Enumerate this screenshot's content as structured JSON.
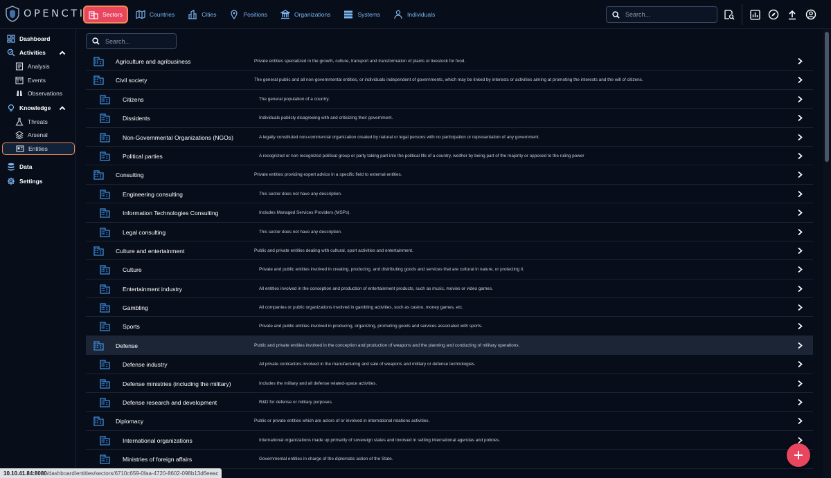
{
  "app": {
    "name": "OPENCTI"
  },
  "topnav": {
    "tabs": [
      {
        "label": "Sectors",
        "icon": "building-icon",
        "active": true
      },
      {
        "label": "Countries",
        "icon": "map-icon",
        "active": false
      },
      {
        "label": "Cities",
        "icon": "city-icon",
        "active": false
      },
      {
        "label": "Positions",
        "icon": "map-pin-icon",
        "active": false
      },
      {
        "label": "Organizations",
        "icon": "bank-icon",
        "active": false
      },
      {
        "label": "Systems",
        "icon": "server-icon",
        "active": false
      },
      {
        "label": "Individuals",
        "icon": "person-icon",
        "active": false
      }
    ],
    "search_placeholder": "Search...",
    "right_icons": [
      "search-document-icon",
      "dashboard-icon",
      "compass-icon",
      "upload-icon",
      "account-icon"
    ]
  },
  "sidebar": {
    "items": [
      {
        "label": "Dashboard",
        "icon": "dashboard-grid-icon",
        "level": "top"
      },
      {
        "label": "Activities",
        "icon": "activities-icon",
        "level": "top",
        "expanded": true
      },
      {
        "label": "Analysis",
        "icon": "analysis-icon",
        "level": "sub"
      },
      {
        "label": "Events",
        "icon": "events-icon",
        "level": "sub"
      },
      {
        "label": "Observations",
        "icon": "binoculars-icon",
        "level": "sub"
      },
      {
        "label": "Knowledge",
        "icon": "knowledge-icon",
        "level": "top",
        "expanded": true
      },
      {
        "label": "Threats",
        "icon": "threats-icon",
        "level": "sub"
      },
      {
        "label": "Arsenal",
        "icon": "arsenal-icon",
        "level": "sub"
      },
      {
        "label": "Entities",
        "icon": "entities-icon",
        "level": "sub",
        "selected": true
      },
      {
        "label": "Data",
        "icon": "database-icon",
        "level": "top"
      },
      {
        "label": "Settings",
        "icon": "settings-icon",
        "level": "top"
      }
    ]
  },
  "list": {
    "search_placeholder": "Search...",
    "rows": [
      {
        "name": "Agriculture and agribusiness",
        "level": "parent",
        "description": "Private entities specialized in the growth, culture, transport and transformation of plants or livestock for food."
      },
      {
        "name": "Civil society",
        "level": "parent",
        "description": "The general public and all non-governmental entities, or individuals independent of governments, which may be linked by interests or activities aiming at promoting the interests and the will of citizens."
      },
      {
        "name": "Citizens",
        "level": "child",
        "description": "The general population of a country."
      },
      {
        "name": "Dissidents",
        "level": "child",
        "description": "Individuals publicly disagreeing with and criticizing their government."
      },
      {
        "name": "Non-Governmental Organizations (NGOs)",
        "level": "child",
        "description": "A legally constituted non-commercial organization created by natural or legal persons with no participation or representation of any government."
      },
      {
        "name": "Political parties",
        "level": "child",
        "description": "A recognized or non recognized political group or party taking part into the political life of a country, weither by being part of the majority or opposed to the ruling power"
      },
      {
        "name": "Consulting",
        "level": "parent",
        "description": "Private entities providing expert advice in a specific field to external entities."
      },
      {
        "name": "Engineering consulting",
        "level": "child",
        "description": "This sector does not have any description."
      },
      {
        "name": "Information Technologies Consulting",
        "level": "child",
        "description": "Includes Managed Services Providers (MSPs)."
      },
      {
        "name": "Legal consulting",
        "level": "child",
        "description": "This sector does not have any description."
      },
      {
        "name": "Culture and entertainment",
        "level": "parent",
        "description": "Public and private entities dealing with cultural, sport activities and entertainment."
      },
      {
        "name": "Culture",
        "level": "child",
        "description": "Private and public entities involved in creating, producing, and distributing goods and services that are cultural in nature, or protecting it."
      },
      {
        "name": "Entertainment industry",
        "level": "child",
        "description": "All entities involved in the conception and production of entertainment products, such as music, movies or video games."
      },
      {
        "name": "Gambling",
        "level": "child",
        "description": "All companies or public organizations involved in gambling activities, such as casino, money games, etc."
      },
      {
        "name": "Sports",
        "level": "child",
        "description": "Private and public entities involved in producing, organizing, promoting goods and services associated with sports."
      },
      {
        "name": "Defense",
        "level": "parent",
        "hover": true,
        "description": "Public and private entities involved in the conception and production of weapons and the planning and conducting of military operations."
      },
      {
        "name": "Defense industry",
        "level": "child",
        "description": "All private contractors involved in the manufacturing and sale of weapons and military or defense technologies."
      },
      {
        "name": "Defense ministries (including the military)",
        "level": "child",
        "description": "Includes the military and all defense related-space activities."
      },
      {
        "name": "Defense research and development",
        "level": "child",
        "description": "R&D for defense or military purposes."
      },
      {
        "name": "Diplomacy",
        "level": "parent",
        "description": "Public or private entities which are actors of or involved in international relations activities."
      },
      {
        "name": "International organizations",
        "level": "child",
        "description": "International organizations made up primarily of sovereign states and involved in setting international agendas and policies."
      },
      {
        "name": "Ministries of foreign affairs",
        "level": "child",
        "description": "Governmental entities in charge of the diplomatic action of the State."
      }
    ]
  },
  "status_bar": {
    "host": "10.10.41.84:8080",
    "path": "/dashboard/entities/sectors/6710c659-0faa-4720-8602-098b13d6eeac"
  },
  "colors": {
    "background": "#070d19",
    "accent_blue": "#7cb7f4",
    "icon_blue": "#3e8ee0",
    "active_tab": "#e8465e",
    "highlight_outline": "#f28b55",
    "fab": "#e8465e"
  }
}
